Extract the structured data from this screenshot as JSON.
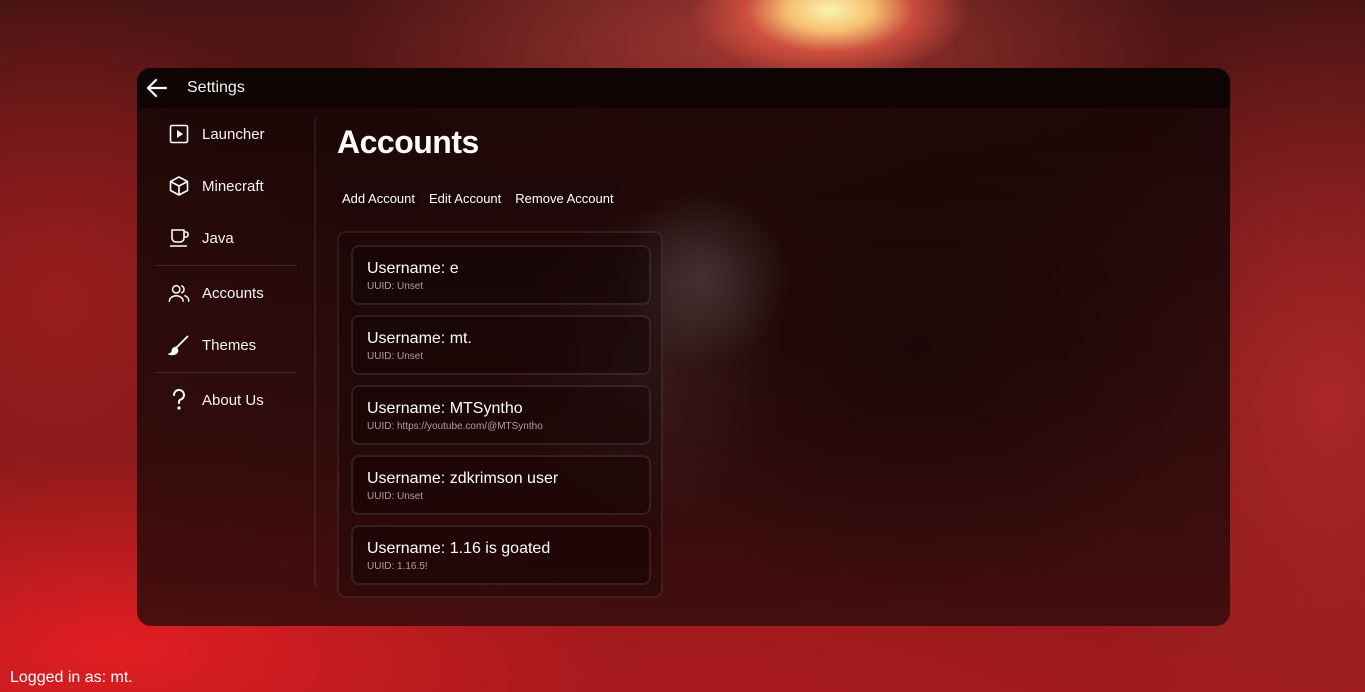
{
  "window": {
    "title": "Settings"
  },
  "sidebar": {
    "items": [
      {
        "label": "Launcher",
        "icon": "play-square-icon"
      },
      {
        "label": "Minecraft",
        "icon": "cube-icon"
      },
      {
        "label": "Java",
        "icon": "coffee-cup-icon"
      },
      {
        "label": "Accounts",
        "icon": "users-icon"
      },
      {
        "label": "Themes",
        "icon": "brush-icon"
      },
      {
        "label": "About Us",
        "icon": "question-mark-icon"
      }
    ]
  },
  "main": {
    "title": "Accounts",
    "actions": {
      "add": "Add Account",
      "edit": "Edit Account",
      "remove": "Remove Account"
    },
    "accounts": [
      {
        "username": "Username: e",
        "uuid": "UUID: Unset"
      },
      {
        "username": "Username: mt.",
        "uuid": "UUID: Unset"
      },
      {
        "username": "Username: MTSyntho",
        "uuid": "UUID: https://youtube.com/@MTSyntho"
      },
      {
        "username": "Username: zdkrimson user",
        "uuid": "UUID: Unset"
      },
      {
        "username": "Username: 1.16 is goated",
        "uuid": "UUID: 1.16.5!"
      }
    ]
  },
  "status": {
    "text": "Logged in as: mt."
  }
}
